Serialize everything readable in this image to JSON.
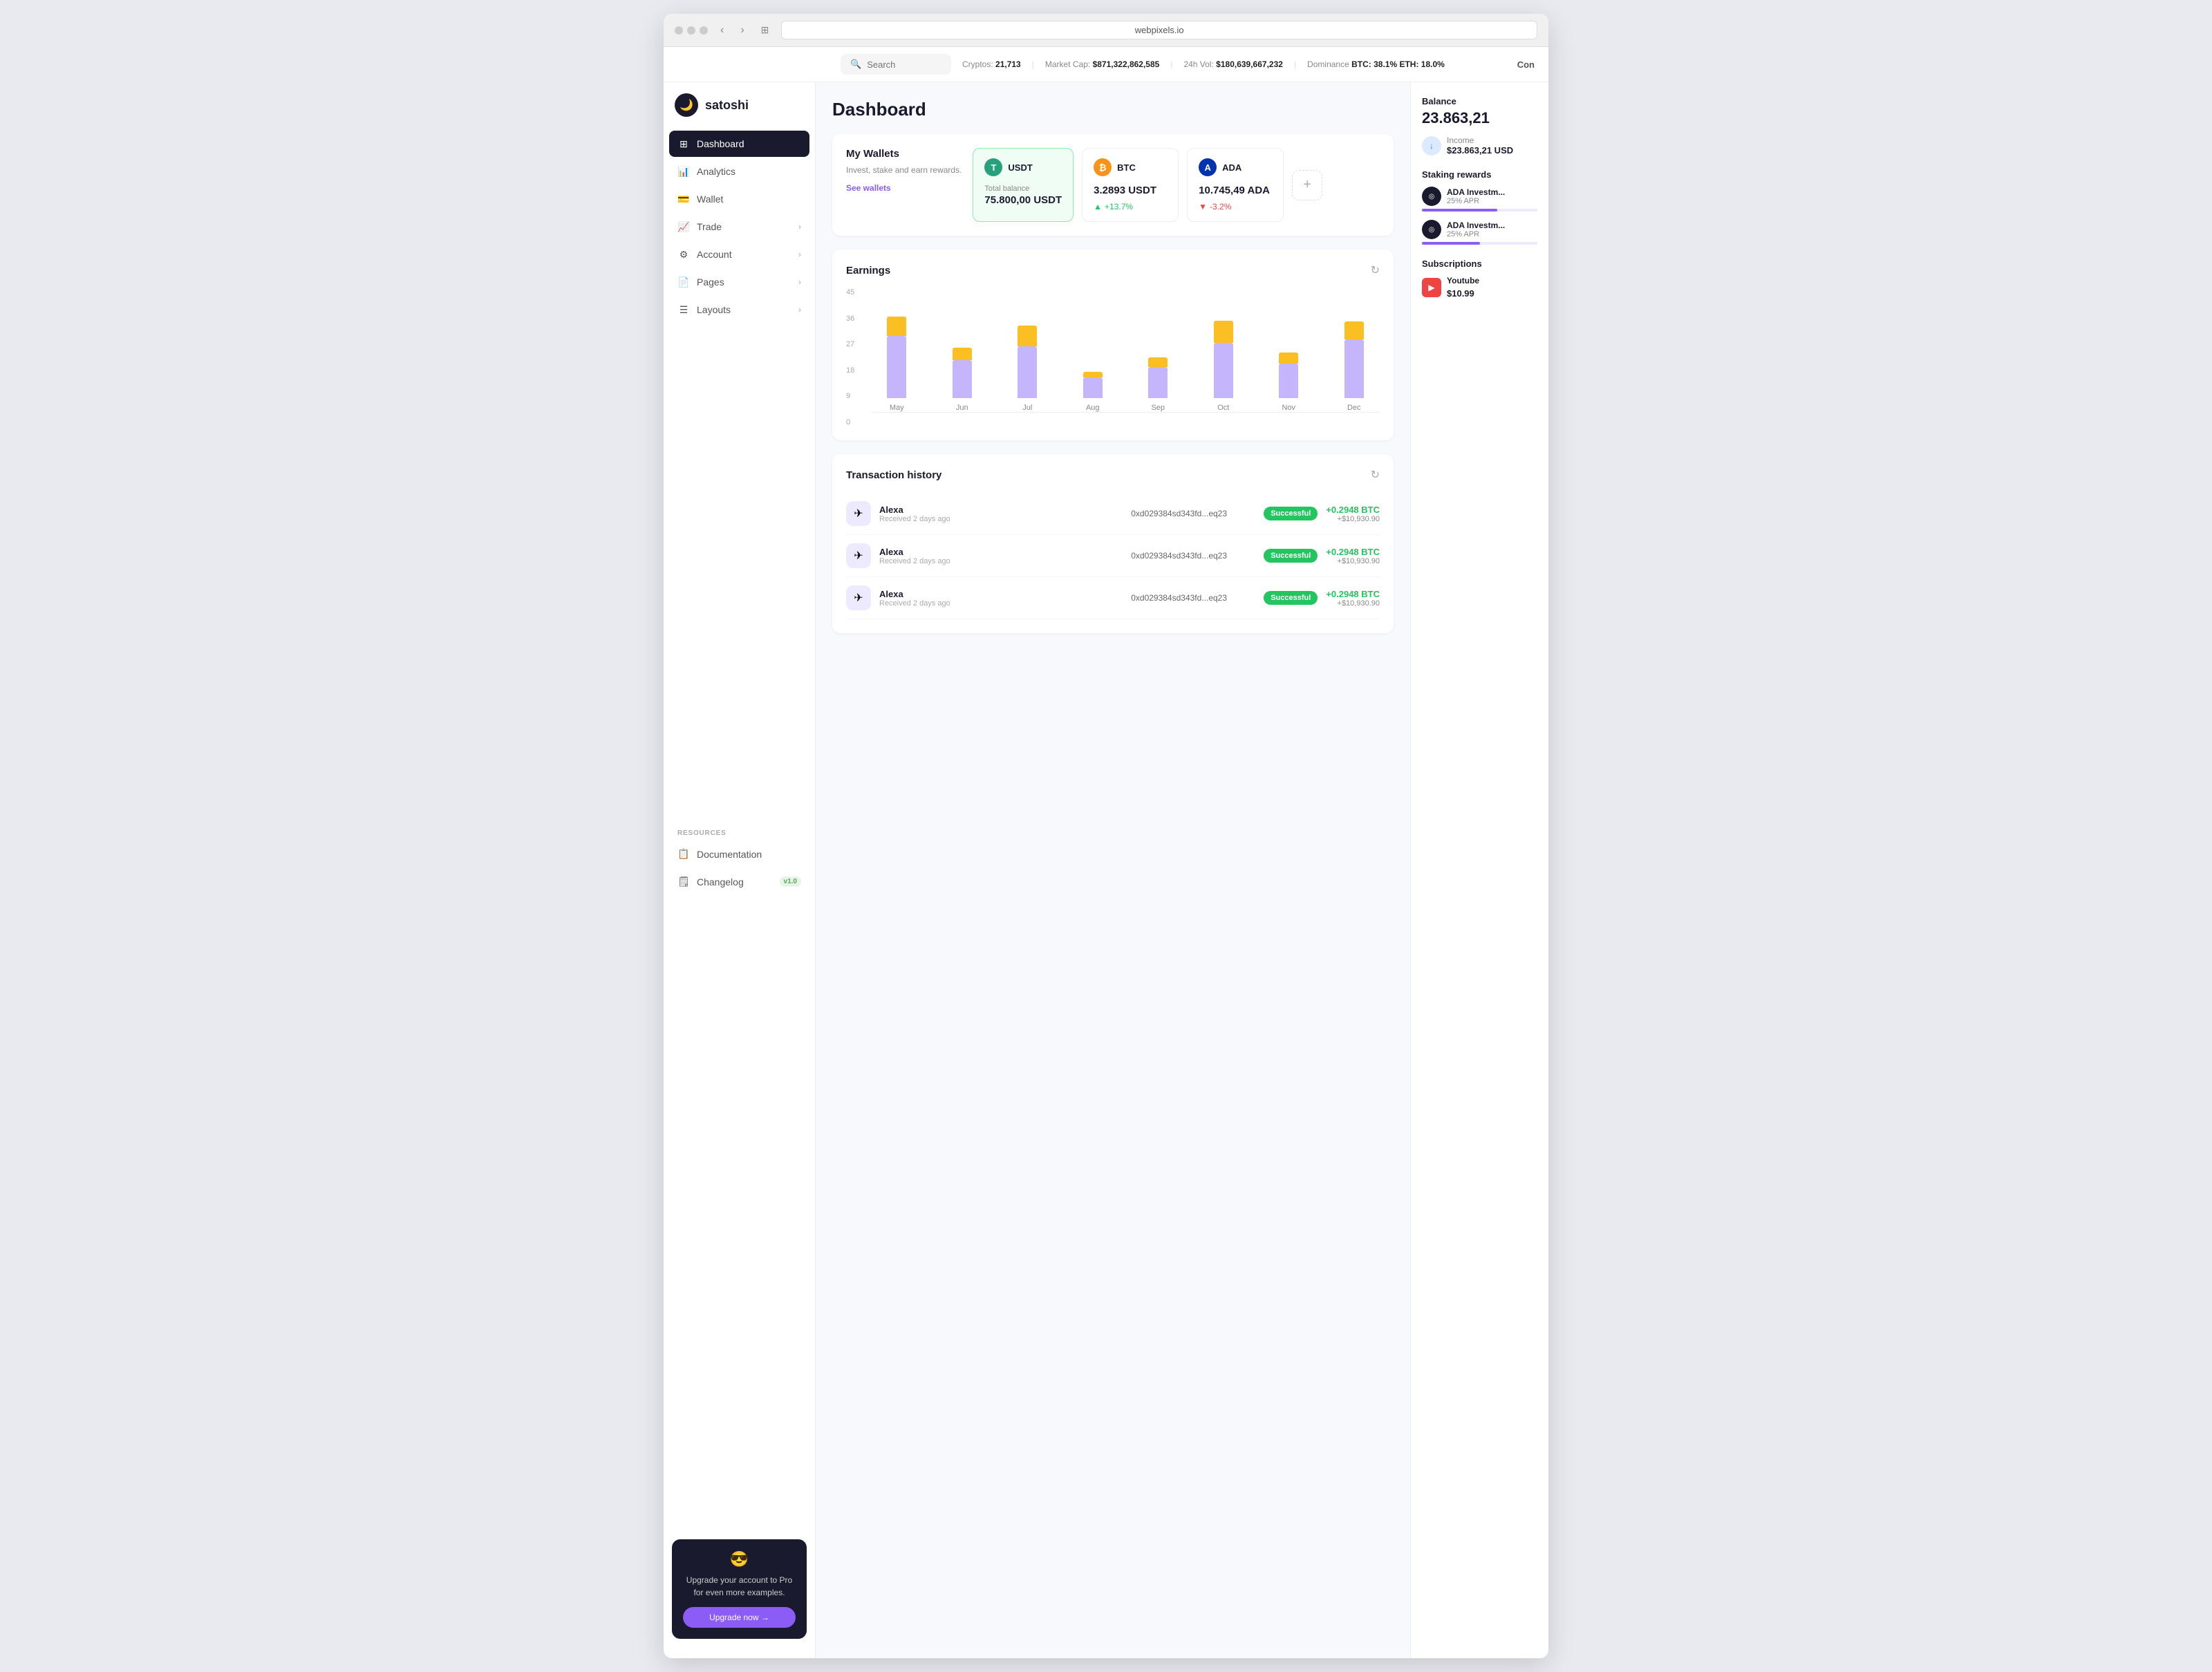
{
  "browser": {
    "url": "webpixels.io"
  },
  "sidebar": {
    "logo": {
      "icon": "🌙",
      "name": "satoshi"
    },
    "nav_items": [
      {
        "id": "dashboard",
        "label": "Dashboard",
        "icon": "⊞",
        "active": true,
        "has_chevron": false
      },
      {
        "id": "analytics",
        "label": "Analytics",
        "icon": "📊",
        "active": false,
        "has_chevron": false
      },
      {
        "id": "wallet",
        "label": "Wallet",
        "icon": "💳",
        "active": false,
        "has_chevron": false
      },
      {
        "id": "trade",
        "label": "Trade",
        "icon": "📈",
        "active": false,
        "has_chevron": true
      },
      {
        "id": "account",
        "label": "Account",
        "icon": "⚙",
        "active": false,
        "has_chevron": true
      },
      {
        "id": "pages",
        "label": "Pages",
        "icon": "📄",
        "active": false,
        "has_chevron": true
      },
      {
        "id": "layouts",
        "label": "Layouts",
        "icon": "☰",
        "active": false,
        "has_chevron": true
      }
    ],
    "resources_label": "RESOURCES",
    "resources": [
      {
        "id": "docs",
        "label": "Documentation",
        "icon": "📋"
      },
      {
        "id": "changelog",
        "label": "Changelog",
        "icon": "🗒",
        "badge": "v1.0"
      }
    ],
    "upgrade_card": {
      "emoji": "😎",
      "text": "Upgrade your account to Pro for even more examples.",
      "button": "Upgrade now →"
    }
  },
  "topbar": {
    "search_placeholder": "Search",
    "cryptos_label": "Cryptos:",
    "cryptos_value": "21,713",
    "market_cap_label": "Market Cap:",
    "market_cap_value": "$871,322,862,585",
    "vol_label": "24h Vol:",
    "vol_value": "$180,639,667,232",
    "dominance_label": "Dominance",
    "dominance_value": "BTC: 38.1% ETH: 18.0%",
    "con_label": "Con"
  },
  "main": {
    "title": "Dashboard",
    "wallets": {
      "heading": "My Wallets",
      "description": "Invest, stake and earn rewards.",
      "see_link": "See wallets",
      "cards": [
        {
          "id": "usdt",
          "symbol": "USDT",
          "color": "usdt",
          "icon_text": "T",
          "active": true,
          "balance_label": "Total balance",
          "balance": "75.800,00 USDT",
          "change": null,
          "change_pct": null
        },
        {
          "id": "btc",
          "symbol": "BTC",
          "color": "btc",
          "icon_text": "₿",
          "active": false,
          "balance_label": "",
          "balance": "3.2893 USDT",
          "change_dir": "up",
          "change_pct": "+13.7%"
        },
        {
          "id": "ada",
          "symbol": "ADA",
          "color": "ada",
          "icon_text": "A",
          "active": false,
          "balance_label": "",
          "balance": "10.745,49 ADA",
          "change_dir": "down",
          "change_pct": "-3.2%"
        }
      ]
    },
    "chart": {
      "title": "Earnings",
      "y_labels": [
        "45",
        "36",
        "27",
        "18",
        "9",
        "0"
      ],
      "bars": [
        {
          "month": "May",
          "purple": 90,
          "yellow": 28
        },
        {
          "month": "Jun",
          "purple": 55,
          "yellow": 18
        },
        {
          "month": "Jul",
          "purple": 75,
          "yellow": 30
        },
        {
          "month": "Aug",
          "purple": 30,
          "yellow": 8
        },
        {
          "month": "Sep",
          "purple": 45,
          "yellow": 14
        },
        {
          "month": "Oct",
          "purple": 80,
          "yellow": 32
        },
        {
          "month": "Nov",
          "purple": 50,
          "yellow": 16
        },
        {
          "month": "Dec",
          "purple": 85,
          "yellow": 26
        }
      ]
    },
    "transactions": {
      "title": "Transaction history",
      "rows": [
        {
          "name": "Alexa",
          "time": "Received 2 days ago",
          "hash": "0xd029384sd343fd...eq23",
          "status": "Successful",
          "amount_btc": "+0.2948 BTC",
          "amount_usd": "+$10,930.90"
        },
        {
          "name": "Alexa",
          "time": "Received 2 days ago",
          "hash": "0xd029384sd343fd...eq23",
          "status": "Successful",
          "amount_btc": "+0.2948 BTC",
          "amount_usd": "+$10,930.90"
        },
        {
          "name": "Alexa",
          "time": "Received 2 days ago",
          "hash": "0xd029384sd343fd...eq23",
          "status": "Successful",
          "amount_btc": "+0.2948 BTC",
          "amount_usd": "+$10,930.90"
        }
      ]
    }
  },
  "right_panel": {
    "balance_label": "Balance",
    "balance_value": "23.863,21",
    "income": {
      "icon": "↓",
      "label": "Income",
      "value": "$23.863,21 USD"
    },
    "staking": {
      "label": "Staking rewards",
      "items": [
        {
          "name": "ADA Investm...",
          "apr": "25% APR",
          "fill_pct": 65
        },
        {
          "name": "ADA Investm...",
          "apr": "25% APR",
          "fill_pct": 50
        }
      ]
    },
    "subscriptions": {
      "label": "Subscriptions",
      "items": [
        {
          "name": "Youtube",
          "icon": "▶",
          "price": "$10.99"
        }
      ]
    }
  }
}
